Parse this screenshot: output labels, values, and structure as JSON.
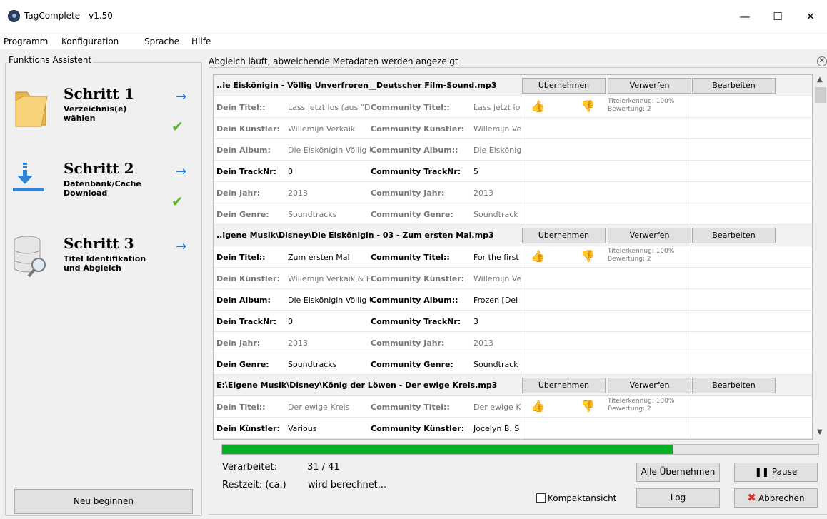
{
  "window": {
    "title": "TagComplete - v1.50",
    "minimize": "—",
    "maximize": "☐",
    "close": "✕"
  },
  "menu": [
    "Programm",
    "Konfiguration",
    "Sprache",
    "Hilfe"
  ],
  "assistant": {
    "legend": "Funktions Assistent",
    "steps": [
      {
        "title": "Schritt 1",
        "desc1": "Verzeichnis(e)",
        "desc2": "wählen",
        "done": true
      },
      {
        "title": "Schritt 2",
        "desc1": "Datenbank/Cache",
        "desc2": "Download",
        "done": true
      },
      {
        "title": "Schritt 3",
        "desc1": "Titel Identifikation",
        "desc2": "und Abgleich",
        "done": false
      }
    ],
    "restart_label": "Neu beginnen"
  },
  "results": {
    "header": "Abgleich läuft, abweichende Metadaten werden angezeigt",
    "btn_accept": "Übernehmen",
    "btn_discard": "Verwerfen",
    "btn_edit": "Bearbeiten",
    "meta1": "Titelerkennug: 100%",
    "meta2": "Bewertung: 2",
    "tracks": [
      {
        "file": "..ie Eiskönigin - Völlig Unverfroren__Deutscher Film-Sound.mp3",
        "rows": [
          {
            "l1": "Dein Titel::",
            "v1": "Lass jetzt los (aus \"Die",
            "l2": "Community Titel::",
            "v2": "Lass jetzt los",
            "dark": false
          },
          {
            "l1": "Dein Künstler:",
            "v1": "Willemijn Verkaik",
            "l2": "Community Künstler:",
            "v2": "Willemijn Ve",
            "dark": false
          },
          {
            "l1": "Dein Album:",
            "v1": "Die Eiskönigin Völlig U",
            "l2": "Community Album::",
            "v2": "Die Eiskönig",
            "dark": false
          },
          {
            "l1": "Dein TrackNr:",
            "v1": "0",
            "l2": "Community TrackNr:",
            "v2": "5",
            "dark": true
          },
          {
            "l1": "Dein Jahr:",
            "v1": "2013",
            "l2": "Community Jahr:",
            "v2": "2013",
            "dark": false
          },
          {
            "l1": "Dein Genre:",
            "v1": "Soundtracks",
            "l2": "Community Genre:",
            "v2": "Soundtrack",
            "dark": false
          }
        ]
      },
      {
        "file": "..igene Musik\\Disney\\Die Eiskönigin - 03 - Zum ersten Mal.mp3",
        "rows": [
          {
            "l1": "Dein Titel::",
            "v1": "Zum ersten Mal",
            "l2": "Community Titel::",
            "v2": "For the first",
            "dark": true
          },
          {
            "l1": "Dein Künstler:",
            "v1": "Willemijn Verkaik & Fr",
            "l2": "Community Künstler:",
            "v2": "Willemijn Ve",
            "dark": false
          },
          {
            "l1": "Dein Album:",
            "v1": "Die Eiskönigin Völlig U",
            "l2": "Community Album::",
            "v2": "Frozen [Del",
            "dark": true
          },
          {
            "l1": "Dein TrackNr:",
            "v1": "0",
            "l2": "Community TrackNr:",
            "v2": "3",
            "dark": true
          },
          {
            "l1": "Dein Jahr:",
            "v1": "2013",
            "l2": "Community Jahr:",
            "v2": "2013",
            "dark": false
          },
          {
            "l1": "Dein Genre:",
            "v1": "Soundtracks",
            "l2": "Community Genre:",
            "v2": "Soundtrack",
            "dark": true
          }
        ]
      },
      {
        "file": "E:\\Eigene Musik\\Disney\\König der Löwen - Der ewige Kreis.mp3",
        "rows": [
          {
            "l1": "Dein Titel::",
            "v1": "Der ewige Kreis",
            "l2": "Community Titel::",
            "v2": "Der ewige K",
            "dark": false
          },
          {
            "l1": "Dein Künstler:",
            "v1": "Various",
            "l2": "Community Künstler:",
            "v2": "Jocelyn B. S",
            "dark": true
          }
        ]
      }
    ]
  },
  "progress": {
    "value": 31,
    "max": 41
  },
  "status": {
    "processed_label": "Verarbeitet:",
    "processed_value": "31 / 41",
    "remaining_label": "Restzeit: (ca.)",
    "remaining_value": "wird berechnet..."
  },
  "actions": {
    "accept_all": "Alle Übernehmen",
    "pause": "Pause",
    "compact": "Kompaktansicht",
    "log": "Log",
    "cancel": "Abbrechen"
  }
}
